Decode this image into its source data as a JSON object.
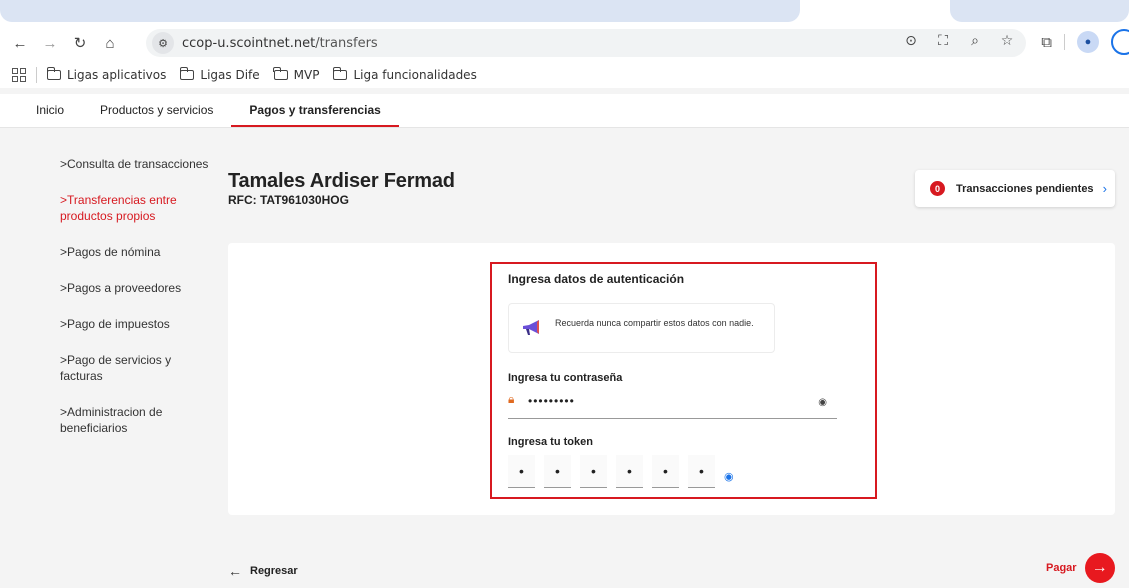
{
  "browser": {
    "url_host": "ccop-u.scointnet.net",
    "url_path": "/transfers",
    "bookmarks": [
      "Ligas aplicativos",
      "Ligas Dife",
      "MVP",
      "Liga funcionalidades"
    ]
  },
  "topnav": {
    "items": [
      "Inicio",
      "Productos y servicios",
      "Pagos y transferencias"
    ]
  },
  "sidebar": {
    "items": [
      "Consulta de transacciones",
      "Transferencias entre productos propios",
      "Pagos de nómina",
      "Pagos a proveedores",
      "Pago de impuestos",
      "Pago de servicios y facturas",
      "Administracion de beneficiarios"
    ]
  },
  "client": {
    "name": "Tamales Ardiser Fermad",
    "rfc": "RFC: TAT961030HOG"
  },
  "pending": {
    "count": "0",
    "label": "Transacciones pendientes"
  },
  "auth": {
    "title": "Ingresa datos de autenticación",
    "notice": "Recuerda nunca compartir estos datos con nadie.",
    "password_label": "Ingresa tu contraseña",
    "password_value": "•••••••••",
    "token_label": "Ingresa tu token",
    "token_digits": [
      "•",
      "•",
      "•",
      "•",
      "•",
      "•"
    ]
  },
  "footer": {
    "back_label": "Regresar",
    "pay_label": "Pagar"
  },
  "colors": {
    "accent_red": "#d71920",
    "link_blue": "#1a73e8"
  }
}
